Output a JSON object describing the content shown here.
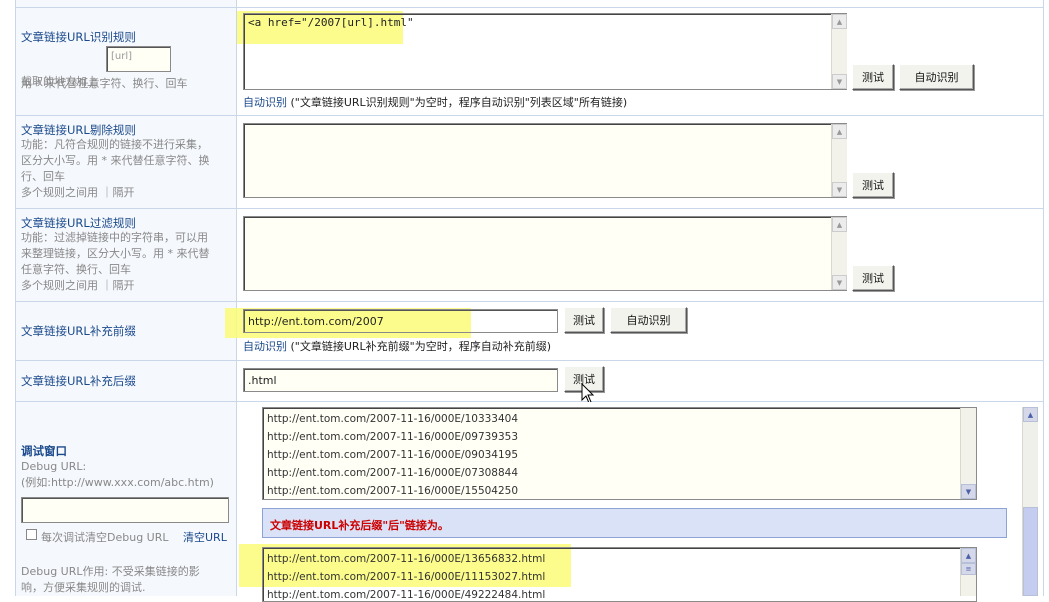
{
  "rows": {
    "identify": {
      "title": "文章链接URL识别规则",
      "sub_prefix": "截取的地方加上",
      "sub_placeholder": "[url]",
      "sub_line2": "用 * 来代替任意字符、换行、回车",
      "textarea_value": "<a href=\"/2007[url].html\"",
      "test_label": "测试",
      "auto_label": "自动识别",
      "auto_link": "自动识别",
      "auto_note": "(\"文章链接URL识别规则\"为空时，程序自动识别\"列表区域\"所有链接)"
    },
    "exclude": {
      "title": "文章链接URL剔除规则",
      "sub": "功能：凡符合规则的链接不进行采集，\n区分大小写。用 * 来代替任意字符、换\n行、回车\n多个规则之间用 ｜隔开",
      "textarea_value": "",
      "test_label": "测试"
    },
    "filter": {
      "title": "文章链接URL过滤规则",
      "sub": "功能：过滤掉链接中的字符串，可以用\n来整理链接，区分大小写。用 * 来代替\n任意字符、换行、回车\n多个规则之间用 ｜隔开",
      "textarea_value": "",
      "test_label": "测试"
    },
    "prefix": {
      "title": "文章链接URL补充前缀",
      "input_value": "http://ent.tom.com/2007",
      "test_label": "测试",
      "auto_label": "自动识别",
      "auto_link": "自动识别",
      "auto_note": "(\"文章链接URL补充前缀\"为空时，程序自动补充前缀)"
    },
    "suffix": {
      "title": "文章链接URL补充后缀",
      "input_value": ".html",
      "test_label": "测试"
    },
    "debug": {
      "title": "调试窗口",
      "sub": "Debug URL:\n(例如:http://www.xxx.com/abc.htm)",
      "url_value": "",
      "clear_checkbox_label": "每次调试清空Debug URL",
      "clear_link": "清空URL",
      "usage": "Debug URL作用: 不受采集链接的影\n响，方便采集规则的调试."
    }
  },
  "debug_window": {
    "list1": [
      "http://ent.tom.com/2007-11-16/000E/10333404",
      "http://ent.tom.com/2007-11-16/000E/09739353",
      "http://ent.tom.com/2007-11-16/000E/09034195",
      "http://ent.tom.com/2007-11-16/000E/07308844",
      "http://ent.tom.com/2007-11-16/000E/15504250"
    ],
    "banner": "文章链接URL补充后缀\"后\"链接为。",
    "list2": [
      "http://ent.tom.com/2007-11-16/000E/13656832.html",
      "http://ent.tom.com/2007-11-16/000E/11153027.html",
      "http://ent.tom.com/2007-11-16/000E/49222484.html"
    ]
  },
  "colors": {
    "highlight": "#fbfb78",
    "label_text": "#1b4a8c",
    "banner_bg": "#d9e2f6",
    "banner_text": "#cc0000"
  }
}
